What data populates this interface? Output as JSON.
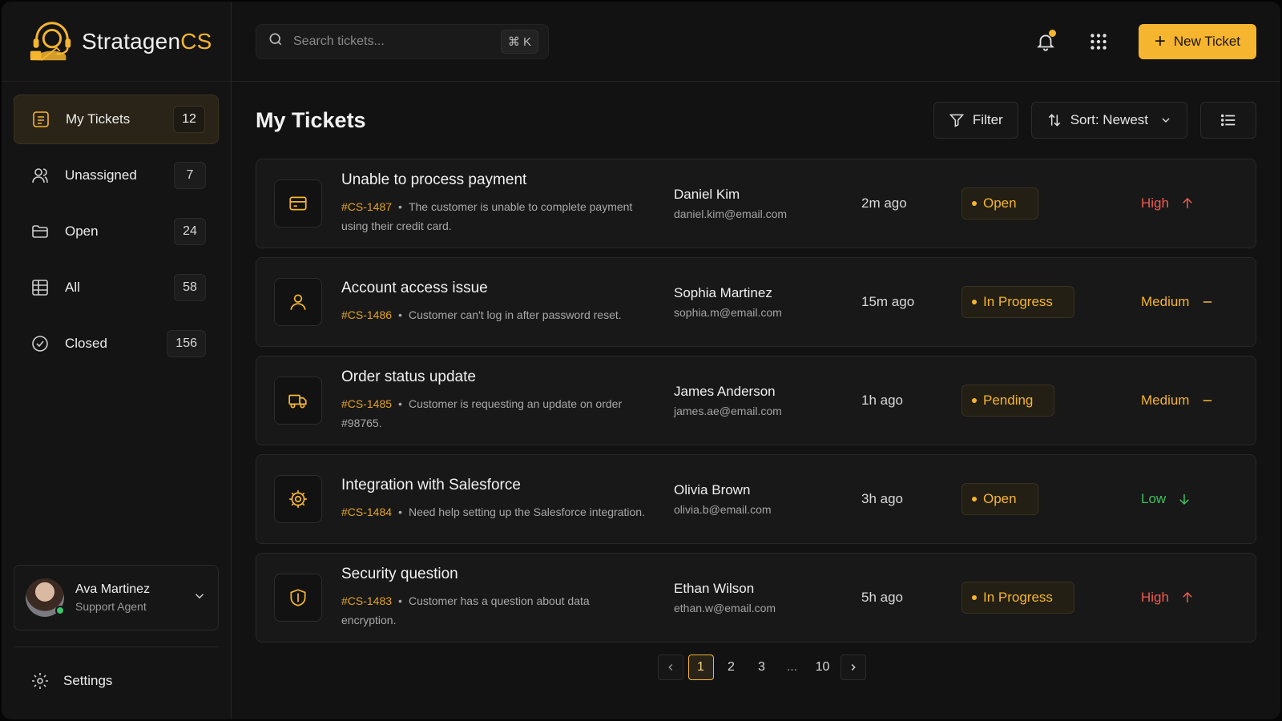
{
  "brand": {
    "name_main": "Stratagen",
    "name_accent": "CS"
  },
  "colors": {
    "accent": "#f5b52e",
    "high": "#f05a4f",
    "medium": "#f5b52e",
    "low": "#3fbf5f",
    "background": "#121212"
  },
  "sidebar": {
    "items": [
      {
        "label": "My Tickets",
        "count": "12",
        "icon": "ticket-icon",
        "active": true
      },
      {
        "label": "Unassigned",
        "count": "7",
        "icon": "users-icon"
      },
      {
        "label": "Open",
        "count": "24",
        "icon": "folder-open-icon"
      },
      {
        "label": "All",
        "count": "58",
        "icon": "table-icon"
      },
      {
        "label": "Closed",
        "count": "156",
        "icon": "check-circle-icon"
      }
    ],
    "user": {
      "name": "Ava Martinez",
      "role": "Support Agent",
      "status": "online"
    },
    "settings_label": "Settings"
  },
  "topbar": {
    "search_placeholder": "Search tickets...",
    "search_shortcut": "⌘ K",
    "new_ticket_label": "New Ticket"
  },
  "page": {
    "title": "My Tickets",
    "filter_label": "Filter",
    "sort_label": "Sort: Newest"
  },
  "tickets": [
    {
      "title": "Unable to process payment",
      "id": "#CS-1487",
      "description": "The customer is unable to complete payment using their credit card.",
      "customer": "Daniel Kim",
      "email": "daniel.kim@email.com",
      "time": "2m ago",
      "status": "Open",
      "priority": "High",
      "icon": "credit-card-icon"
    },
    {
      "title": "Account access issue",
      "id": "#CS-1486",
      "description": "Customer can't log in after password reset.",
      "customer": "Sophia Martinez",
      "email": "sophia.m@email.com",
      "time": "15m ago",
      "status": "In Progress",
      "priority": "Medium",
      "icon": "user-icon"
    },
    {
      "title": "Order status update",
      "id": "#CS-1485",
      "description": "Customer is requesting an update on order #98765.",
      "customer": "James Anderson",
      "email": "james.ae@email.com",
      "time": "1h ago",
      "status": "Pending",
      "priority": "Medium",
      "icon": "truck-icon"
    },
    {
      "title": "Integration with Salesforce",
      "id": "#CS-1484",
      "description": "Need help setting up the Salesforce integration.",
      "customer": "Olivia Brown",
      "email": "olivia.b@email.com",
      "time": "3h ago",
      "status": "Open",
      "priority": "Low",
      "icon": "gear-icon"
    },
    {
      "title": "Security question",
      "id": "#CS-1483",
      "description": "Customer has a question about data encryption.",
      "customer": "Ethan Wilson",
      "email": "ethan.w@email.com",
      "time": "5h ago",
      "status": "In Progress",
      "priority": "High",
      "icon": "shield-icon"
    }
  ],
  "pagination": {
    "pages": [
      "1",
      "2",
      "3",
      "...",
      "10"
    ],
    "current": "1"
  }
}
